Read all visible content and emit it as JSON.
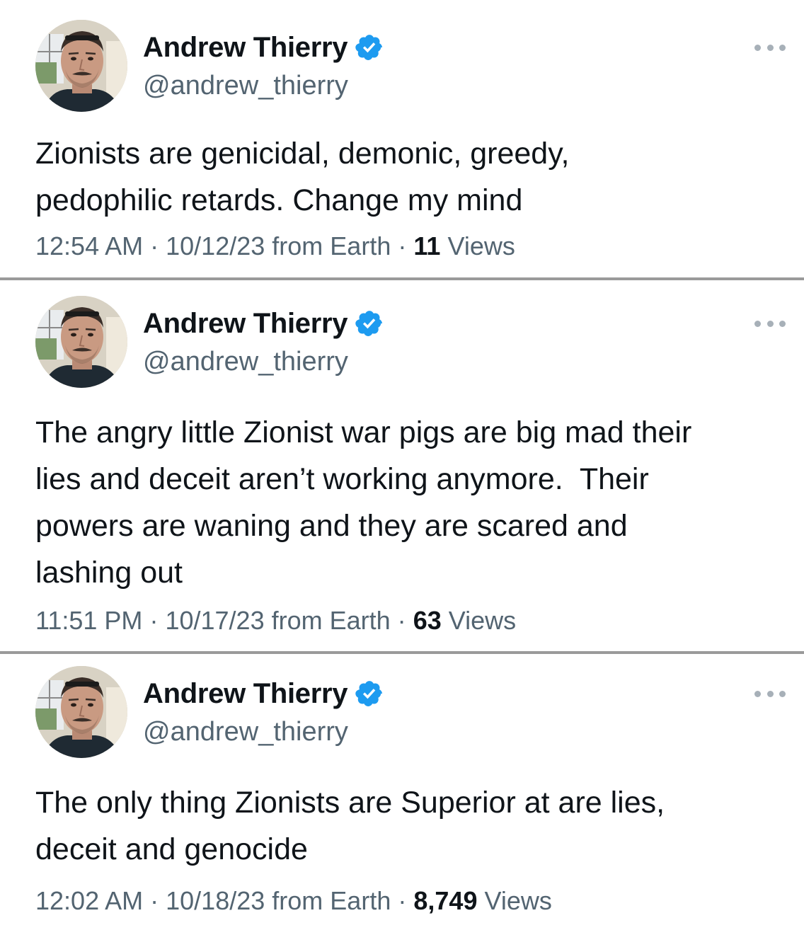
{
  "tweets": [
    {
      "author": "Andrew Thierry",
      "handle": "@andrew_thierry",
      "text": "Zionists are genicidal, demonic, greedy,\npedophilic retards. Change my mind",
      "time": "12:54 AM",
      "date": "10/12/23",
      "source": "from Earth",
      "views_count": "11",
      "views_label": "Views"
    },
    {
      "author": "Andrew Thierry",
      "handle": "@andrew_thierry",
      "text": "The angry little Zionist war pigs are big mad their\nlies and deceit aren’t working anymore.  Their\npowers are waning and they are scared and\nlashing out",
      "time": "11:51 PM",
      "date": "10/17/23",
      "source": "from Earth",
      "views_count": "63",
      "views_label": "Views"
    },
    {
      "author": "Andrew Thierry",
      "handle": "@andrew_thierry",
      "text": "The only thing Zionists are Superior at are lies,\ndeceit and genocide",
      "time": "12:02 AM",
      "date": "10/18/23",
      "source": "from Earth",
      "views_count": "8,749",
      "views_label": "Views"
    }
  ],
  "separator": "·",
  "colors": {
    "verified": "#1d9bf0",
    "secondary_text": "#536471",
    "primary_text": "#0f1419",
    "divider": "#9a9a9a"
  },
  "icons": {
    "verified": "verified-badge-icon",
    "more": "more-options-icon"
  }
}
